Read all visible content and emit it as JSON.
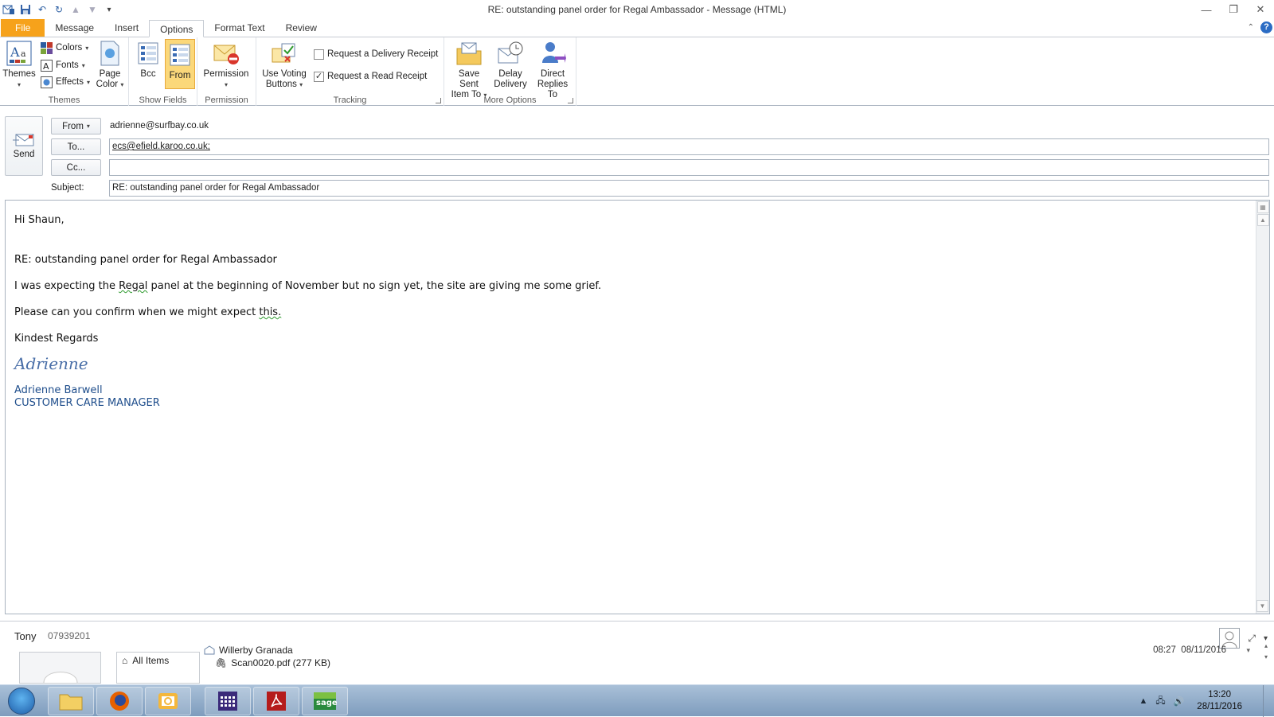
{
  "window": {
    "title": "RE: outstanding panel order for Regal Ambassador  - Message (HTML)"
  },
  "tabs": [
    "File",
    "Message",
    "Insert",
    "Options",
    "Format Text",
    "Review"
  ],
  "active_tab": "Options",
  "ribbon": {
    "themes_group": {
      "label": "Themes",
      "themes_btn": "Themes",
      "colors": "Colors",
      "fonts": "Fonts",
      "effects": "Effects",
      "page_color_line1": "Page",
      "page_color_line2": "Color"
    },
    "show_fields_group": {
      "label": "Show Fields",
      "bcc": "Bcc",
      "from": "From"
    },
    "permission_group": {
      "label": "Permission",
      "permission": "Permission"
    },
    "tracking_group": {
      "label": "Tracking",
      "voting_line1": "Use Voting",
      "voting_line2": "Buttons",
      "delivery_receipt": "Request a Delivery Receipt",
      "delivery_checked": false,
      "read_receipt": "Request a Read Receipt",
      "read_checked": true
    },
    "more_options_group": {
      "label": "More Options",
      "save_sent_line1": "Save Sent",
      "save_sent_line2": "Item To",
      "delay_line1": "Delay",
      "delay_line2": "Delivery",
      "direct_line1": "Direct",
      "direct_line2": "Replies To"
    }
  },
  "header": {
    "send": "Send",
    "from_btn": "From",
    "from_value": "adrienne@surfbay.co.uk",
    "to_btn": "To...",
    "to_value": "ecs@efield.karoo.co.uk;",
    "cc_btn": "Cc...",
    "cc_value": "",
    "subject_label": "Subject:",
    "subject_value": "RE: outstanding panel order for Regal Ambassador"
  },
  "body": {
    "greeting": "Hi Shaun,",
    "re_line": "RE: outstanding panel order for Regal Ambassador",
    "para1_pre": "I was expecting the ",
    "para1_word": "Regal",
    "para1_post": " panel at the beginning of November but no sign yet, the site are giving me some grief.",
    "para2_pre": "Please can you confirm when we might expect ",
    "para2_word": "this.",
    "closing": "Kindest Regards",
    "signature_script": "Adrienne",
    "sig_name": "Adrienne Barwell",
    "sig_title": "CUSTOMER CARE MANAGER"
  },
  "people_pane": {
    "name": "Tony",
    "phone": "07939201",
    "nav_all_items": "All Items",
    "item_subject": "Willerby Granada",
    "item_attachment": "Scan0020.pdf (277 KB)",
    "item_time": "08:27",
    "item_date": "08/11/2016"
  },
  "taskbar": {
    "time": "13:20",
    "date": "28/11/2016",
    "apps": [
      "windows-explorer",
      "firefox",
      "outlook",
      "calendar-app",
      "adobe-reader",
      "sage"
    ]
  },
  "colors": {
    "file_tab": "#f6a21b",
    "selected_button": "#fbd87a",
    "signature_blue": "#1f4e8c"
  }
}
